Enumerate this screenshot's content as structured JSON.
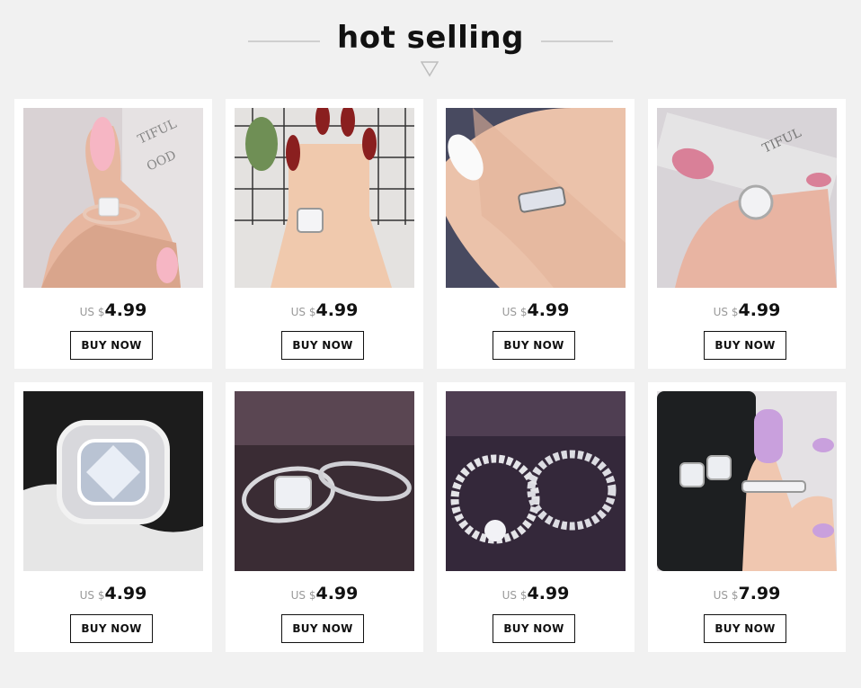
{
  "section": {
    "title": "hot selling",
    "divider_icon": "triangle-down-outline-icon"
  },
  "currency_label": "US $",
  "buy_label": "BUY NOW",
  "products": [
    {
      "price": "4.99",
      "image": "ring-on-hand-pink-nail-photo"
    },
    {
      "price": "4.99",
      "image": "ring-on-hand-red-nails-photo"
    },
    {
      "price": "4.99",
      "image": "ring-on-hand-white-nail-photo"
    },
    {
      "price": "4.99",
      "image": "ring-held-with-pink-nails-photo"
    },
    {
      "price": "4.99",
      "image": "halo-diamond-ring-closeup-photo"
    },
    {
      "price": "4.99",
      "image": "ring-set-on-velvet-photo"
    },
    {
      "price": "4.99",
      "image": "eternity-ring-set-on-velvet-photo"
    },
    {
      "price": "7.99",
      "image": "ring-and-earrings-set-photo"
    }
  ]
}
